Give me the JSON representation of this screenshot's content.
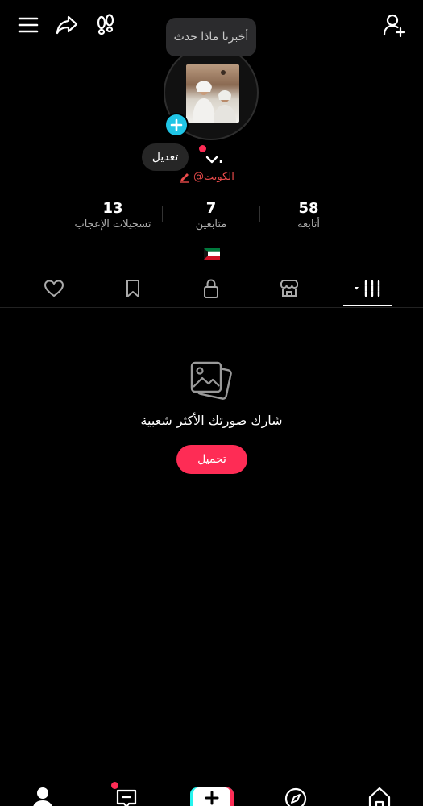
{
  "profile": {
    "status_bubble": "أخبرنا ماذا حدث",
    "edit_label": "تعديل",
    "username_mark": ".",
    "handle": "@الكويت"
  },
  "stats": [
    {
      "value": "58",
      "label": "أتابعه"
    },
    {
      "value": "7",
      "label": "متابعين"
    },
    {
      "value": "13",
      "label": "تسجيلات الإعجاب"
    }
  ],
  "empty_state": {
    "message": "شارك صورتك الأكثر شعبية",
    "action_label": "تحميل"
  },
  "colors": {
    "accent": "#fe2c55",
    "add_badge": "#20c5e6",
    "background": "#000000",
    "handle_text": "#ea4b4b"
  }
}
